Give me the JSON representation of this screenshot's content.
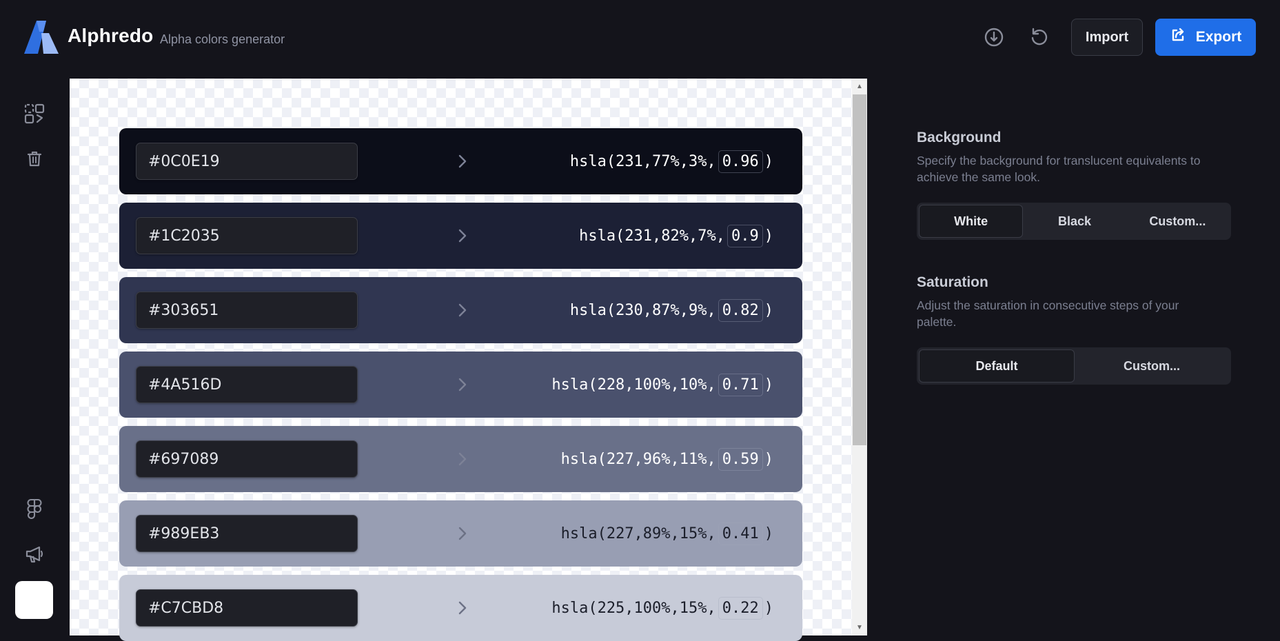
{
  "app": {
    "name": "Alphredo",
    "tagline": "Alpha colors generator"
  },
  "header": {
    "icons": [
      "info-icon",
      "reset-icon"
    ],
    "import_label": "Import",
    "export_label": "Export"
  },
  "rail": {
    "top_icons": [
      "shapes-icon",
      "trash-icon"
    ],
    "bottom_icons": [
      "figma-icon",
      "megaphone-icon"
    ],
    "swatch_color": "#ffffff"
  },
  "rows": [
    {
      "hex": "#0C0E19",
      "prefix": "hsla(231,77%,3%,",
      "alpha": "0.96",
      "suffix": ")",
      "color": "#0c0e19",
      "text_color": "#ffffff"
    },
    {
      "hex": "#1C2035",
      "prefix": "hsla(231,82%,7%,",
      "alpha": "0.9",
      "suffix": ")",
      "color": "#1c2035",
      "text_color": "#ffffff"
    },
    {
      "hex": "#303651",
      "prefix": "hsla(230,87%,9%,",
      "alpha": "0.82",
      "suffix": ")",
      "color": "#303651",
      "text_color": "#ffffff"
    },
    {
      "hex": "#4A516D",
      "prefix": "hsla(228,100%,10%,",
      "alpha": "0.71",
      "suffix": ")",
      "color": "#4a516d",
      "text_color": "#ffffff"
    },
    {
      "hex": "#697089",
      "prefix": "hsla(227,96%,11%,",
      "alpha": "0.59",
      "suffix": ")",
      "color": "#697089",
      "text_color": "#ffffff"
    },
    {
      "hex": "#989EB3",
      "prefix": "hsla(227,89%,15%,",
      "alpha": "0.41",
      "suffix": ")",
      "color": "#989eb3",
      "text_color": "#1b1e2a"
    },
    {
      "hex": "#C7CBD8",
      "prefix": "hsla(225,100%,15%,",
      "alpha": "0.22",
      "suffix": ")",
      "color": "#c7cbd8",
      "text_color": "#1b1e2a"
    }
  ],
  "settings": {
    "background": {
      "title": "Background",
      "description": "Specify the background for translucent equivalents to achieve the same look.",
      "options": [
        "White",
        "Black",
        "Custom..."
      ],
      "selected": "White"
    },
    "saturation": {
      "title": "Saturation",
      "description": "Adjust the saturation in consecutive steps of your palette.",
      "options": [
        "Default",
        "Custom..."
      ],
      "selected": "Default"
    }
  },
  "colors": {
    "app_bg": "#14141b",
    "accent": "#1f6ee8",
    "logo_light": "#8fb4f7",
    "logo_dark": "#2f6fe0"
  }
}
